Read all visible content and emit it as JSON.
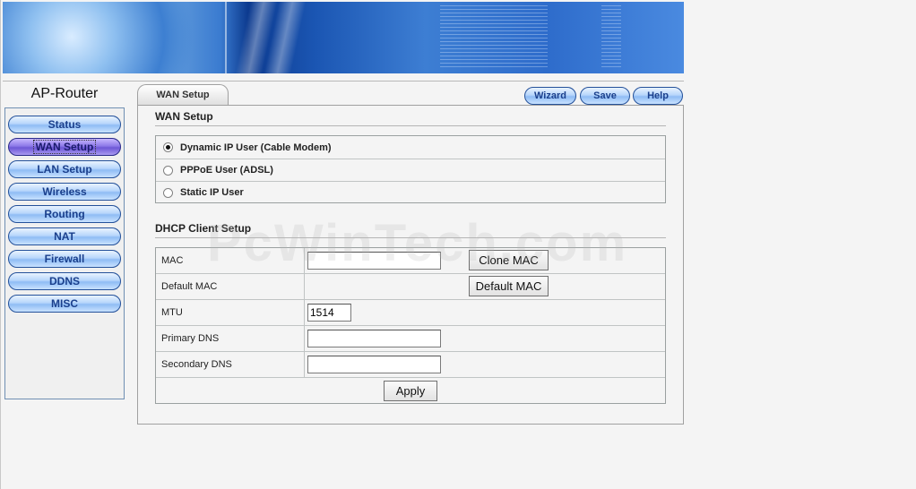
{
  "brand": "AP-Router",
  "nav": [
    {
      "label": "Status"
    },
    {
      "label": "WAN Setup",
      "active": true
    },
    {
      "label": "LAN Setup"
    },
    {
      "label": "Wireless"
    },
    {
      "label": "Routing"
    },
    {
      "label": "NAT"
    },
    {
      "label": "Firewall"
    },
    {
      "label": "DDNS"
    },
    {
      "label": "MISC"
    }
  ],
  "tab": "WAN Setup",
  "actions": {
    "wizard": "Wizard",
    "save": "Save",
    "help": "Help"
  },
  "wan": {
    "title": "WAN Setup",
    "options": [
      {
        "label": "Dynamic IP User (Cable Modem)",
        "checked": true
      },
      {
        "label": "PPPoE User (ADSL)",
        "checked": false
      },
      {
        "label": "Static IP User",
        "checked": false
      }
    ]
  },
  "dhcp": {
    "title": "DHCP Client Setup",
    "mac": {
      "label": "MAC",
      "value": "",
      "button": "Clone MAC"
    },
    "default_mac": {
      "label": "Default MAC",
      "value": "",
      "button": "Default MAC"
    },
    "mtu": {
      "label": "MTU",
      "value": "1514"
    },
    "primary_dns": {
      "label": "Primary DNS",
      "value": ""
    },
    "secondary_dns": {
      "label": "Secondary DNS",
      "value": ""
    },
    "apply": "Apply"
  },
  "watermark": "PcWinTech.com"
}
